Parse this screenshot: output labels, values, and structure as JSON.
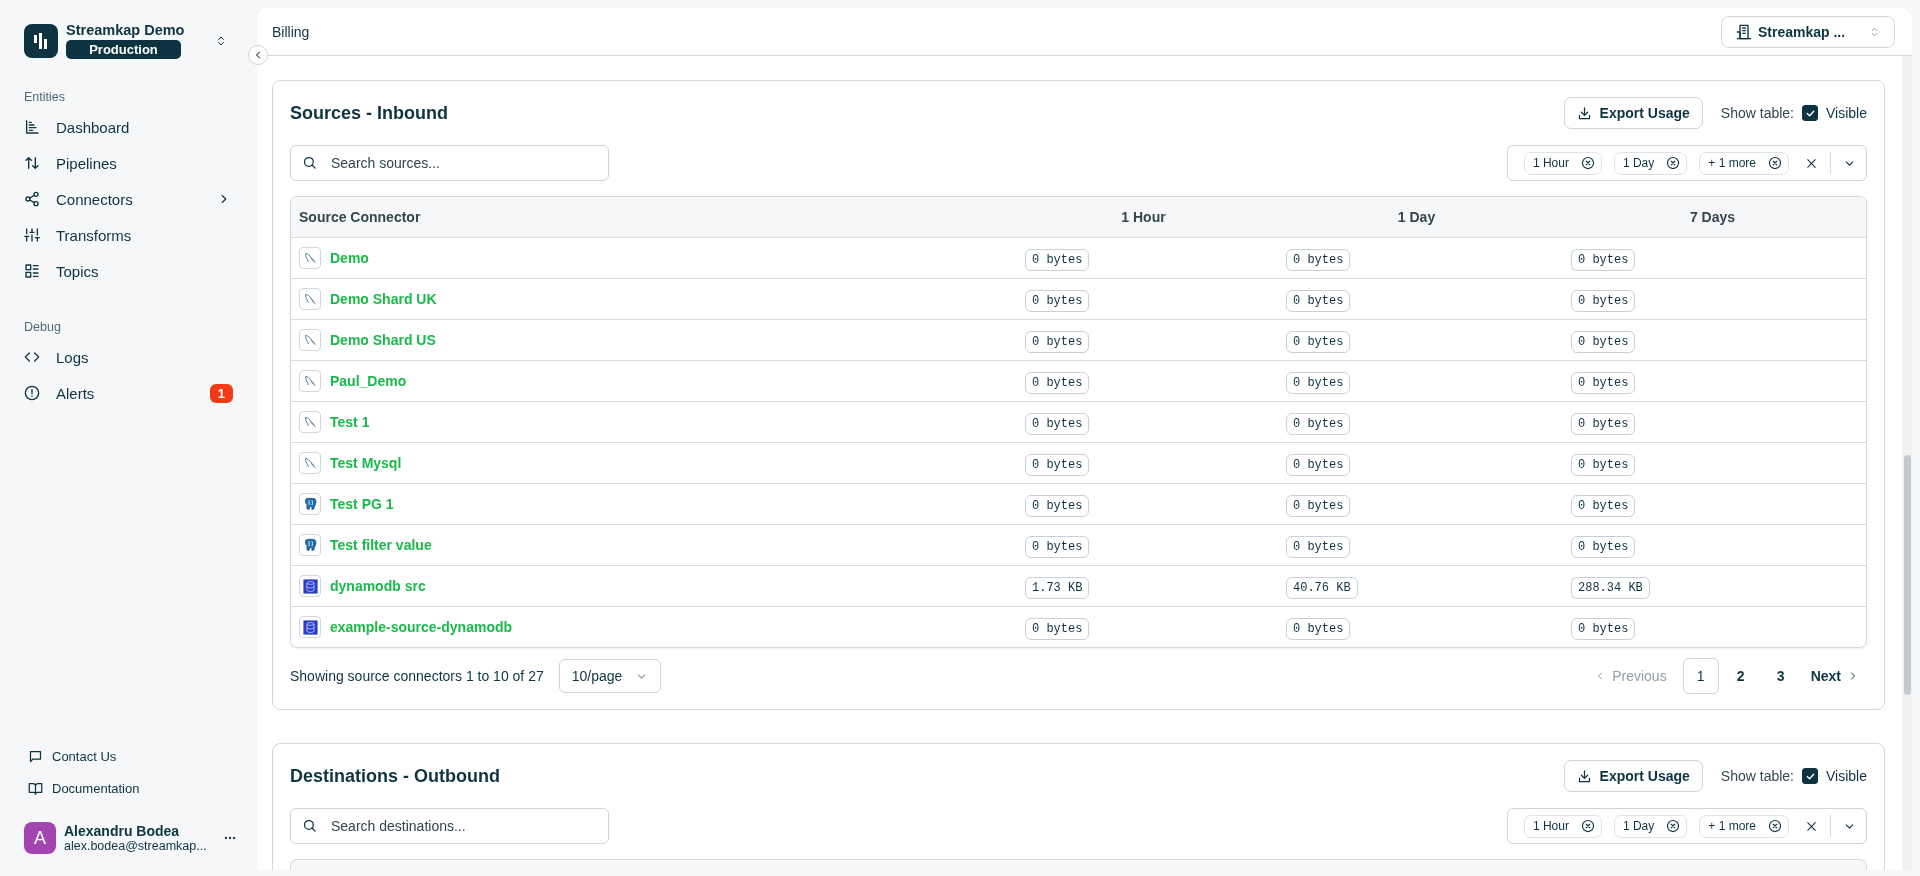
{
  "sidebar": {
    "org": {
      "name": "Streamkap Demo",
      "environment": "Production"
    },
    "groups": [
      {
        "title": "Entities",
        "items": [
          {
            "label": "Dashboard",
            "kind": "chart",
            "has_submenu": false
          },
          {
            "label": "Pipelines",
            "kind": "arrows",
            "has_submenu": false
          },
          {
            "label": "Connectors",
            "kind": "share",
            "has_submenu": true
          },
          {
            "label": "Transforms",
            "kind": "sliders",
            "has_submenu": false
          },
          {
            "label": "Topics",
            "kind": "list",
            "has_submenu": false
          }
        ]
      },
      {
        "title": "Debug",
        "items": [
          {
            "label": "Logs",
            "kind": "code",
            "has_submenu": false
          },
          {
            "label": "Alerts",
            "kind": "alert",
            "has_submenu": false,
            "badge": "1"
          }
        ]
      }
    ],
    "footer_links": [
      {
        "label": "Contact Us",
        "kind": "message"
      },
      {
        "label": "Documentation",
        "kind": "book"
      }
    ],
    "user": {
      "initial": "A",
      "name": "Alexandru Bodea",
      "email": "alex.bodea@streamkap..."
    }
  },
  "header": {
    "title": "Billing",
    "workspace": "Streamkap ..."
  },
  "sections": [
    {
      "title": "Sources - Inbound",
      "export_label": "Export Usage",
      "show_table": {
        "label": "Show table:",
        "checked": true,
        "text": "Visible"
      },
      "search": {
        "placeholder": "Search sources..."
      },
      "filters": [
        "1 Hour",
        "1 Day",
        "+ 1 more"
      ],
      "table": {
        "columns": [
          "Source Connector",
          "1 Hour",
          "1 Day",
          "7 Days"
        ],
        "rows": [
          {
            "name": "Demo",
            "kind": "mysql",
            "values": [
              "0 bytes",
              "0 bytes",
              "0 bytes"
            ]
          },
          {
            "name": "Demo Shard UK",
            "kind": "mysql",
            "values": [
              "0 bytes",
              "0 bytes",
              "0 bytes"
            ]
          },
          {
            "name": "Demo Shard US",
            "kind": "mysql",
            "values": [
              "0 bytes",
              "0 bytes",
              "0 bytes"
            ]
          },
          {
            "name": "Paul_Demo",
            "kind": "mysql",
            "values": [
              "0 bytes",
              "0 bytes",
              "0 bytes"
            ]
          },
          {
            "name": "Test 1",
            "kind": "mysql",
            "values": [
              "0 bytes",
              "0 bytes",
              "0 bytes"
            ]
          },
          {
            "name": "Test Mysql",
            "kind": "mysql",
            "values": [
              "0 bytes",
              "0 bytes",
              "0 bytes"
            ]
          },
          {
            "name": "Test PG 1",
            "kind": "postgres",
            "values": [
              "0 bytes",
              "0 bytes",
              "0 bytes"
            ]
          },
          {
            "name": "Test filter value",
            "kind": "postgres",
            "values": [
              "0 bytes",
              "0 bytes",
              "0 bytes"
            ]
          },
          {
            "name": "dynamodb src",
            "kind": "dynamodb",
            "values": [
              "1.73 KB",
              "40.76 KB",
              "288.34 KB"
            ]
          },
          {
            "name": "example-source-dynamodb",
            "kind": "dynamodb",
            "values": [
              "0 bytes",
              "0 bytes",
              "0 bytes"
            ]
          }
        ]
      },
      "pagination": {
        "summary": "Showing source connectors 1 to 10 of 27",
        "page_size": "10/page",
        "previous": {
          "label": "Previous",
          "disabled": true
        },
        "pages": [
          {
            "label": "1",
            "selected": true
          },
          {
            "label": "2",
            "selected": false
          },
          {
            "label": "3",
            "selected": false
          }
        ],
        "next": {
          "label": "Next",
          "disabled": false
        }
      }
    },
    {
      "title": "Destinations - Outbound",
      "export_label": "Export Usage",
      "show_table": {
        "label": "Show table:",
        "checked": true,
        "text": "Visible"
      },
      "search": {
        "placeholder": "Search destinations..."
      },
      "filters": [
        "1 Hour",
        "1 Day",
        "+ 1 more"
      ]
    }
  ]
}
